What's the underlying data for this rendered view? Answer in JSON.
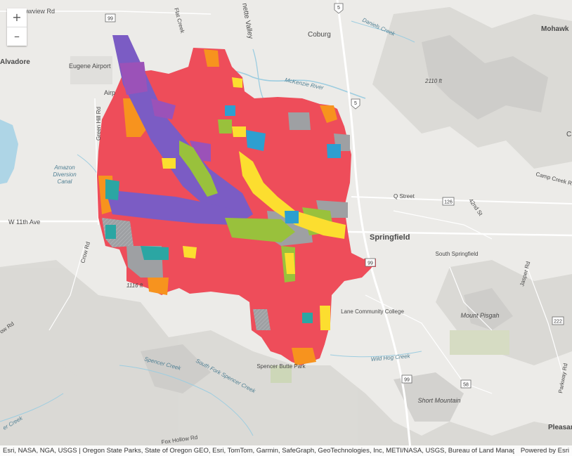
{
  "zoom": {
    "in_label": "+",
    "out_label": "–"
  },
  "places": {
    "meadowview": "Meadowview Rd",
    "coburg": "Coburg",
    "mohawk": "Mohawk",
    "alvadore": "Alvadore",
    "eugene_airport": "Eugene Airport",
    "airport": "Airp",
    "green_hill": "Green Hill Rd",
    "w11th": "W 11th Ave",
    "springfield": "Springfield",
    "q_street": "Q Street",
    "south_springfield": "South Springfield",
    "lane_cc": "Lane Community College",
    "mount_pisgah": "Mount Pisgah",
    "spencer_butte": "Spencer Butte Park",
    "short_mountain": "Short Mountain",
    "pleasant": "Pleasant",
    "jasper": "Jasper Rd",
    "parkway": "Parkway Rd",
    "camp_creek": "Camp Creek Rd",
    "crow": "Crow Rd",
    "fox_hollow": "Fox Hollow Rd",
    "elev_2110": "2110 ft",
    "elev_1116": "1116 ft",
    "willamette": "nette Valley",
    "low_rd": "ow Rd",
    "holly_hill": "Flat Creek",
    "creek_left": "er Creek",
    "c_right": "C",
    "fifth_st": "42nd St"
  },
  "water": {
    "mckenzie": "McKenzie River",
    "daniels": "Daniels Creek",
    "amazon": "Amazon Diversion Canal",
    "amazon_l1": "Amazon",
    "amazon_l2": "Diversion",
    "amazon_l3": "Canal",
    "spencer": "Spencer Creek",
    "south_fork": "South Fork Spencer Creek",
    "wild_hog": "Wild Hog Creek"
  },
  "shields": {
    "r99": "99",
    "i5": "5",
    "i5b": "5",
    "r126": "126",
    "r222": "222",
    "r58": "58",
    "r99b": "99",
    "r99c": "99"
  },
  "colors": {
    "red": "#ee4d5a",
    "orange": "#f7931e",
    "yellow": "#fcde2f",
    "green": "#99c13c",
    "teal": "#2ba6a3",
    "blue": "#2d9fd0",
    "purple": "#7b5cc4",
    "violet": "#9b52b8",
    "gray": "#9ea0a3"
  },
  "attribution": {
    "sources": "Esri, NASA, NGA, USGS | Oregon State Parks, State of Oregon GEO, Esri, TomTom, Garmin, SafeGraph, GeoTechnologies, Inc, METI/NASA, USGS, Bureau of Land Management…",
    "powered": "Powered by Esri"
  }
}
